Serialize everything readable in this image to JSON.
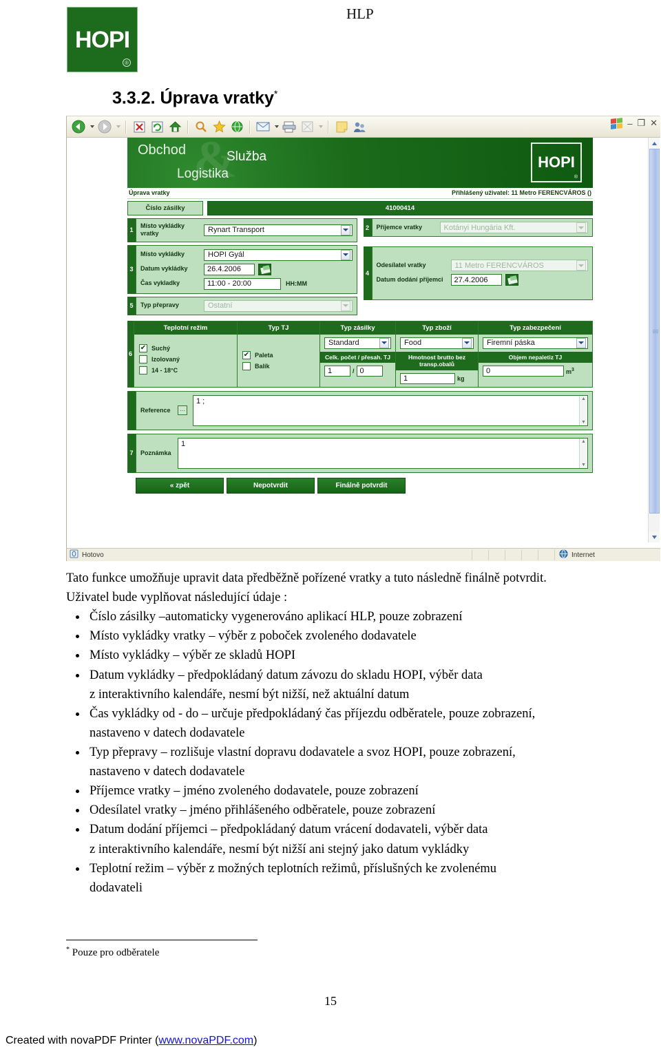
{
  "document": {
    "header_title": "HLP",
    "section_heading": "3.3.2. Úprava vratky",
    "section_heading_marker": "*",
    "footnote_marker": "*",
    "footnote_text": "Pouze pro odběratele",
    "page_number": "15",
    "footer_prefix": "Created with novaPDF Printer (",
    "footer_link": "www.novaPDF.com",
    "footer_suffix": ")"
  },
  "logo": {
    "wordmark": "HOPI",
    "registered": "®"
  },
  "browser": {
    "status_left": "Hotovo",
    "status_zone": "Internet",
    "toolbar_icons": [
      "back-icon",
      "back-dropdown-icon",
      "forward-icon",
      "forward-dropdown-icon",
      "stop-icon",
      "refresh-icon",
      "home-icon",
      "search-icon",
      "favorites-icon",
      "history-icon",
      "mail-icon",
      "mail-dropdown-icon",
      "print-icon",
      "edit-icon",
      "edit-dropdown-icon",
      "notes-icon",
      "messenger-icon"
    ],
    "window_controls": {
      "minimize": "–",
      "restore": "❐",
      "close": "✕"
    }
  },
  "banner": {
    "line1": "Obchod",
    "ampersand": "&",
    "line2": "Služba",
    "line3": "Logistika",
    "logo": "HOPI",
    "logo_registered": "®"
  },
  "app": {
    "page_title": "Úprava vratky",
    "user_label": "Přihlášený uživatel: 11 Metro FERENCVÁROS ()",
    "shipment": {
      "label": "Číslo zásilky",
      "value": "41000414"
    },
    "section1": {
      "number": "1",
      "label": "Místo vykládky vratky",
      "value": "Rynart Transport",
      "disabled": false
    },
    "section2": {
      "number": "2",
      "label": "Příjemce vratky",
      "value": "Kotányi Hungária Kft.",
      "disabled": true
    },
    "section3": {
      "number": "3",
      "place_label": "Místo vykládky",
      "place_value": "HOPI Gyál",
      "date_label": "Datum vykládky",
      "date_value": "26.4.2006",
      "time_label": "Čas vykladky",
      "time_value": "11:00 - 20:00",
      "time_hint": "HH:MM"
    },
    "section4": {
      "number": "4",
      "sender_label": "Odesílatel vratky",
      "sender_value": "11 Metro FERENCVÁROS",
      "delivery_label": "Datum dodání příjemci",
      "delivery_value": "27.4.2006"
    },
    "section5": {
      "number": "5",
      "label": "Typ přepravy",
      "value": "Ostatní",
      "disabled": true
    },
    "section6": {
      "number": "6",
      "columns": [
        {
          "header": "Teplotní režim"
        },
        {
          "header": "Typ TJ"
        },
        {
          "header": "Typ zásilky"
        },
        {
          "header": "Typ zboží"
        },
        {
          "header": "Typ zabezpečení"
        }
      ],
      "temperature_options": [
        {
          "label": "Suchý",
          "checked": true
        },
        {
          "label": "Izolovaný",
          "checked": false
        },
        {
          "label": "14 - 18°C",
          "checked": false
        }
      ],
      "tj_options": [
        {
          "label": "Paleta",
          "checked": true
        },
        {
          "label": "Balík",
          "checked": false
        }
      ],
      "shipment_type": "Standard",
      "goods_type": "Food",
      "security_type": "Firemní páska",
      "count_sublabel": "Celk. počet / přesah. TJ",
      "count_value": "1",
      "count_separator": "/",
      "overhang_value": "0",
      "weight_sublabel": "Hmotnost brutto bez transp.obalů",
      "weight_value": "1",
      "weight_unit": "kg",
      "volume_sublabel": "Objem nepaletiz TJ",
      "volume_value": "0",
      "volume_unit": "m",
      "volume_unit_sup": "3"
    },
    "reference": {
      "label": "Reference",
      "button": "···",
      "value": "1 ;"
    },
    "note": {
      "number": "7",
      "label": "Poznámka",
      "value": "1"
    },
    "buttons": [
      {
        "label": "« zpět"
      },
      {
        "label": "Nepotvrdit"
      },
      {
        "label": "Finálně potvrdit"
      }
    ]
  },
  "body": {
    "intro1": "Tato funkce umožňuje upravit data předběžně pořízené vratky a tuto následně finálně potvrdit.",
    "intro2": "Uživatel bude vyplňovat následující údaje :",
    "bullets": [
      {
        "text": "Číslo zásilky –automaticky vygenerováno aplikací HLP,  pouze zobrazení"
      },
      {
        "text": "Místo vykládky vratky – výběr z poboček zvoleného dodavatele"
      },
      {
        "text": "Místo vykládky – výběr ze skladů HOPI"
      },
      {
        "text": "Datum vykládky – předpokládaný datum závozu do skladu HOPI, výběr data",
        "cont": "z interaktivního kalendáře, nesmí být nižší, než aktuální datum"
      },
      {
        "text": "Čas vykládky od - do – určuje předpokládaný čas příjezdu odběratele, pouze zobrazení,",
        "cont": "nastaveno v datech dodavatele"
      },
      {
        "text": "Typ přepravy – rozlišuje vlastní dopravu dodavatele a svoz HOPI, pouze zobrazení,",
        "cont": "nastaveno v datech dodavatele"
      },
      {
        "text": "Příjemce vratky – jméno zvoleného dodavatele, pouze zobrazení"
      },
      {
        "text": "Odesílatel vratky –  jméno přihlášeného odběratele, pouze zobrazení"
      },
      {
        "text": "Datum dodání příjemci – předpokládaný datum vrácení dodavateli, výběr data",
        "cont": "z interaktivního kalendáře, nesmí být nižší ani stejný jako datum vykládky"
      },
      {
        "text": "Teplotní režim – výběr z možných teplotních režimů, příslušných ke zvolenému",
        "cont": "dodavateli"
      }
    ]
  }
}
